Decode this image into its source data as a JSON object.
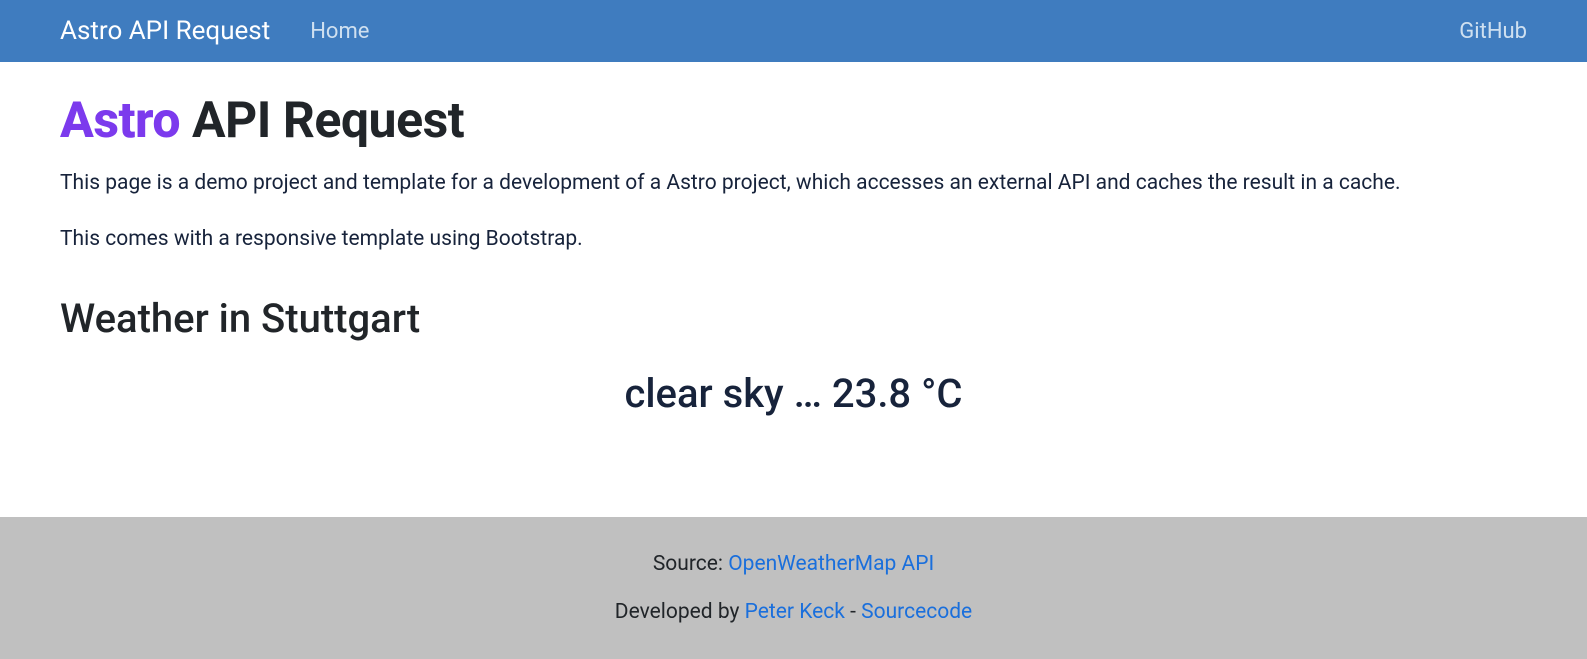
{
  "navbar": {
    "brand": "Astro API Request",
    "home_label": "Home",
    "github_label": "GitHub"
  },
  "title": {
    "astro": "Astro",
    "rest": " API Request"
  },
  "intro": {
    "p1": "This page is a demo project and template for a development of a Astro project, which accesses an external API and caches the result in a cache.",
    "p2": "This comes with a responsive template using Bootstrap."
  },
  "weather": {
    "heading": "Weather in Stuttgart",
    "display": "clear sky … 23.8 °C"
  },
  "footer": {
    "source_label": "Source: ",
    "source_link": "OpenWeatherMap API",
    "developed_label": "Developed by ",
    "developer_link": "Peter Keck",
    "separator": " - ",
    "sourcecode_link": "Sourcecode"
  }
}
